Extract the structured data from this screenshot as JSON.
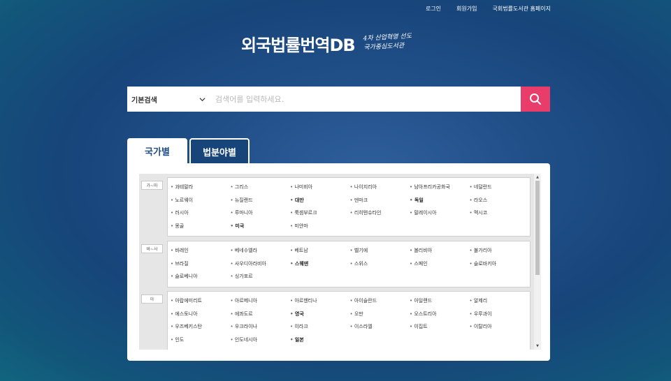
{
  "topnav": {
    "login": "로그인",
    "signup": "회원가입",
    "homepage": "국회법률도서관 홈페이지"
  },
  "brand": {
    "title": "외국법률번역DB",
    "slogan_line1": "4차 산업혁명 선도",
    "slogan_line2": "국가중심도서관"
  },
  "search": {
    "type_label": "기본검색",
    "placeholder": "검색어를 입력하세요."
  },
  "tabs": {
    "by_country": "국가별",
    "by_field": "법분야별"
  },
  "groups": [
    {
      "label": "가~마",
      "countries": [
        {
          "name": "과테말라",
          "bold": false
        },
        {
          "name": "그리스",
          "bold": false
        },
        {
          "name": "나미비아",
          "bold": false
        },
        {
          "name": "나이지리아",
          "bold": false
        },
        {
          "name": "남아프리카공화국",
          "bold": false
        },
        {
          "name": "네덜란드",
          "bold": false
        },
        {
          "name": "노르웨이",
          "bold": false
        },
        {
          "name": "뉴질랜드",
          "bold": false
        },
        {
          "name": "대만",
          "bold": true
        },
        {
          "name": "덴마크",
          "bold": false
        },
        {
          "name": "독일",
          "bold": true
        },
        {
          "name": "라오스",
          "bold": false
        },
        {
          "name": "러시아",
          "bold": false
        },
        {
          "name": "루마니아",
          "bold": false
        },
        {
          "name": "룩셈부르크",
          "bold": false
        },
        {
          "name": "리히텐슈타인",
          "bold": false
        },
        {
          "name": "말레이시아",
          "bold": false
        },
        {
          "name": "멕시코",
          "bold": false
        },
        {
          "name": "몽골",
          "bold": false
        },
        {
          "name": "미국",
          "bold": true
        },
        {
          "name": "미얀마",
          "bold": false
        }
      ]
    },
    {
      "label": "바~사",
      "countries": [
        {
          "name": "바레인",
          "bold": false
        },
        {
          "name": "베네수엘라",
          "bold": false
        },
        {
          "name": "베트남",
          "bold": false
        },
        {
          "name": "벨기에",
          "bold": false
        },
        {
          "name": "볼리비아",
          "bold": false
        },
        {
          "name": "불가리아",
          "bold": false
        },
        {
          "name": "브라질",
          "bold": false
        },
        {
          "name": "사우디아라비아",
          "bold": false
        },
        {
          "name": "스웨덴",
          "bold": true
        },
        {
          "name": "스위스",
          "bold": false
        },
        {
          "name": "스페인",
          "bold": false
        },
        {
          "name": "슬로바키아",
          "bold": false
        },
        {
          "name": "슬로베니아",
          "bold": false
        },
        {
          "name": "싱가포르",
          "bold": false
        }
      ]
    },
    {
      "label": "아",
      "countries": [
        {
          "name": "아랍에미리트",
          "bold": false
        },
        {
          "name": "아르메니아",
          "bold": false
        },
        {
          "name": "아르헨티나",
          "bold": false
        },
        {
          "name": "아이슬란드",
          "bold": false
        },
        {
          "name": "아일랜드",
          "bold": false
        },
        {
          "name": "알제리",
          "bold": false
        },
        {
          "name": "에스토니아",
          "bold": false
        },
        {
          "name": "에콰도르",
          "bold": false
        },
        {
          "name": "영국",
          "bold": true
        },
        {
          "name": "오만",
          "bold": false
        },
        {
          "name": "오스트리아",
          "bold": false
        },
        {
          "name": "우루과이",
          "bold": false
        },
        {
          "name": "우즈베키스탄",
          "bold": false
        },
        {
          "name": "우크라이나",
          "bold": false
        },
        {
          "name": "이라크",
          "bold": false
        },
        {
          "name": "이스라엘",
          "bold": false
        },
        {
          "name": "이집트",
          "bold": false
        },
        {
          "name": "이탈리아",
          "bold": false
        },
        {
          "name": "인도",
          "bold": false
        },
        {
          "name": "인도네시아",
          "bold": false
        },
        {
          "name": "일본",
          "bold": true
        }
      ]
    }
  ]
}
